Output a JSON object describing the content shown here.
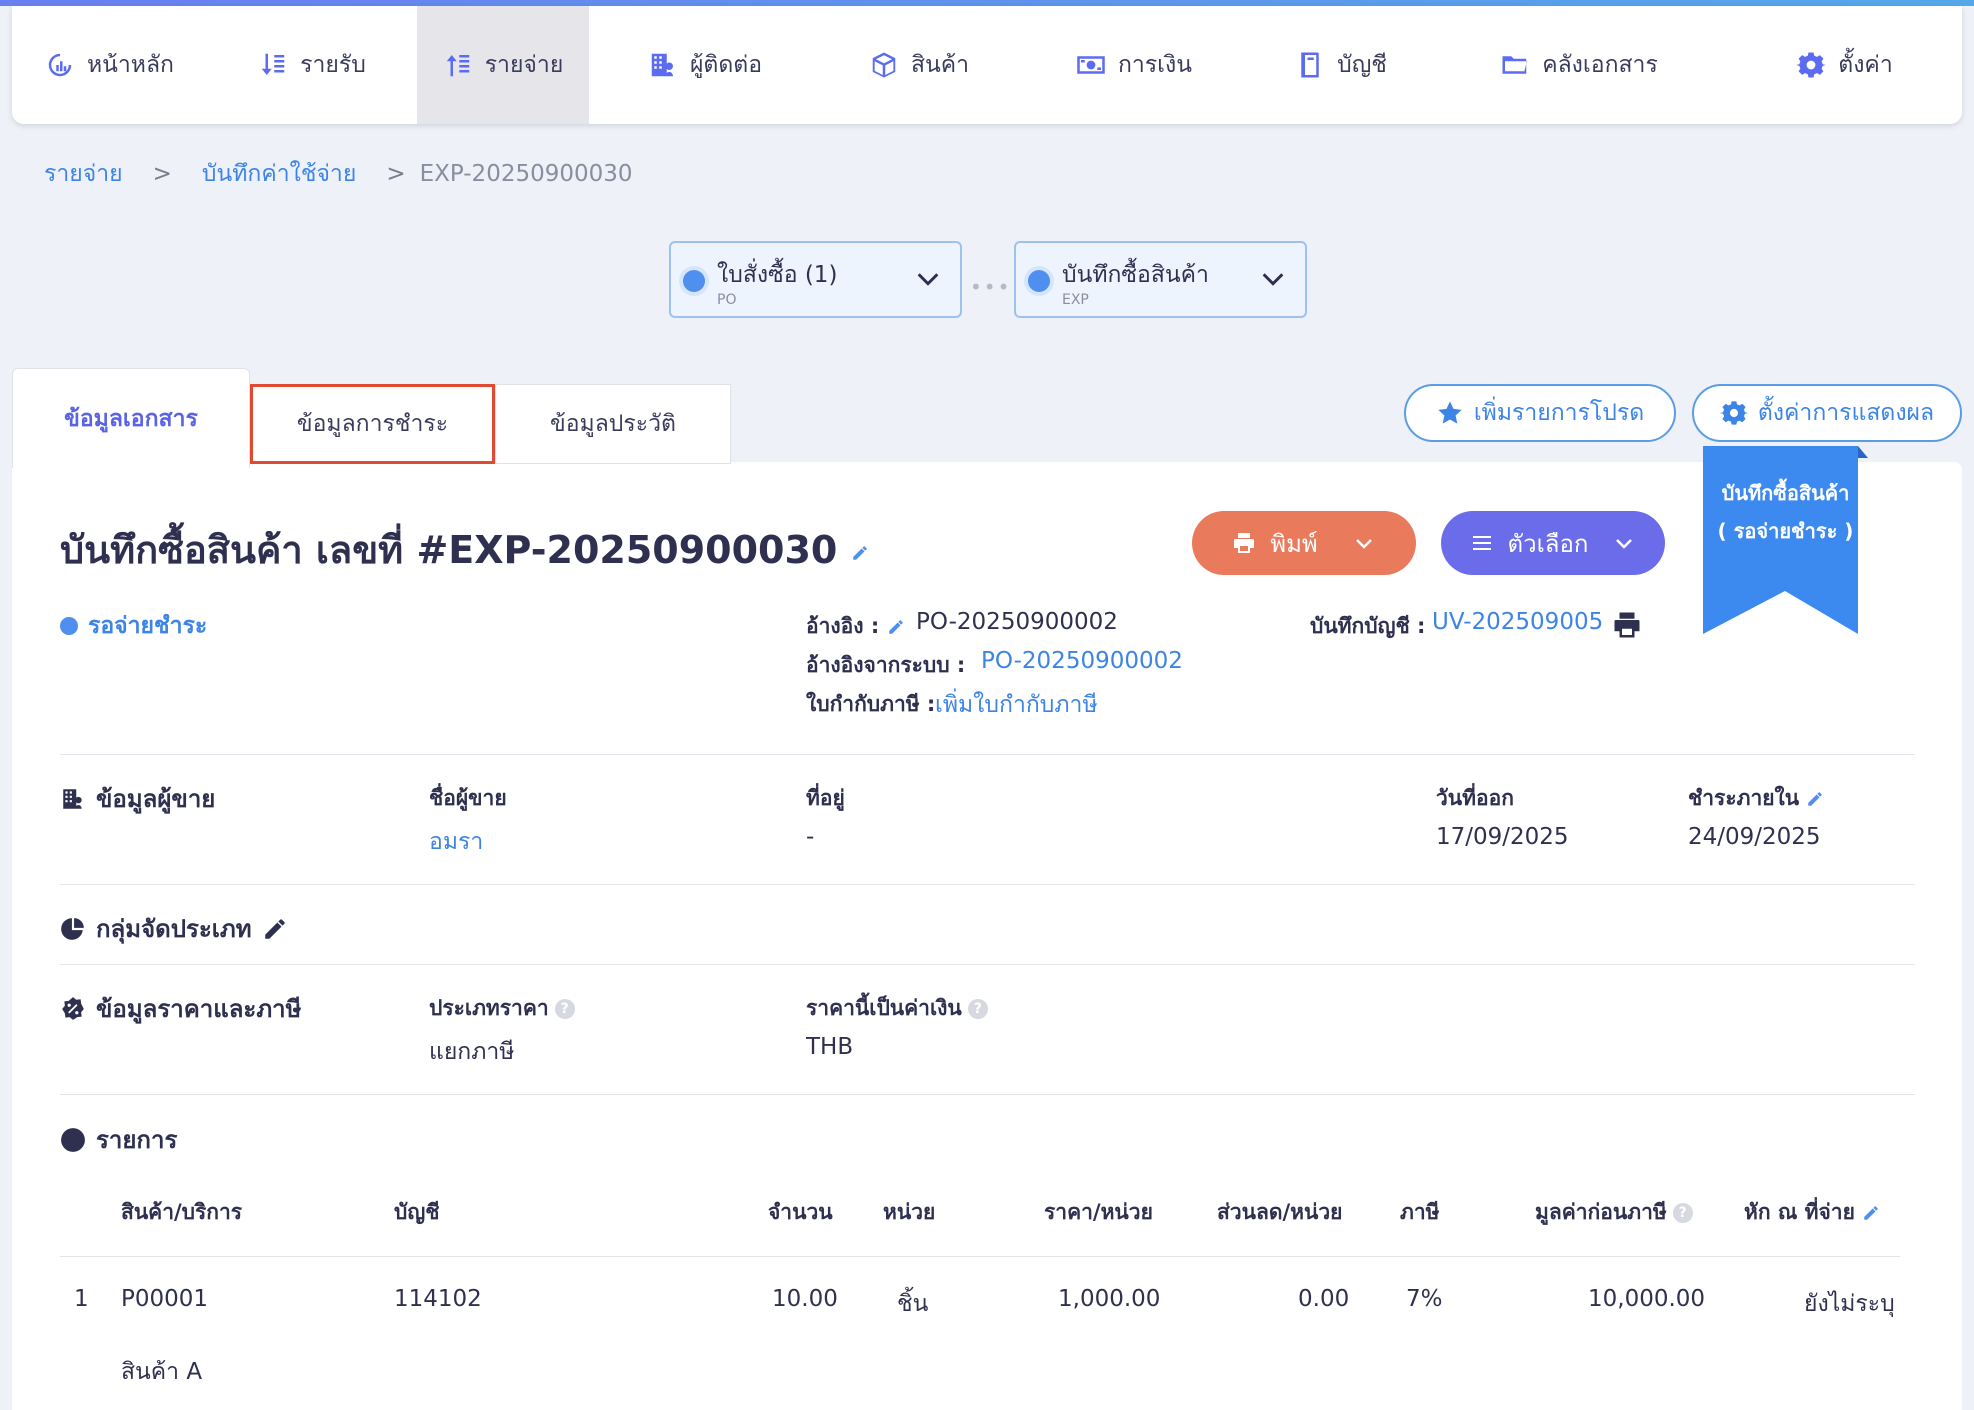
{
  "nav": [
    {
      "label": "หน้าหลัก",
      "icon": "dashboard-icon"
    },
    {
      "label": "รายรับ",
      "icon": "income-icon"
    },
    {
      "label": "รายจ่าย",
      "icon": "expense-icon"
    },
    {
      "label": "ผู้ติดต่อ",
      "icon": "contacts-icon"
    },
    {
      "label": "สินค้า",
      "icon": "box-icon"
    },
    {
      "label": "การเงิน",
      "icon": "money-icon"
    },
    {
      "label": "บัญชี",
      "icon": "book-icon"
    },
    {
      "label": "คลังเอกสาร",
      "icon": "folder-icon"
    },
    {
      "label": "ตั้งค่า",
      "icon": "gear-icon"
    }
  ],
  "breadcrumb": {
    "item1": "รายจ่าย",
    "item2": "บันทึกค่าใช้จ่าย",
    "current": "EXP-20250900030",
    "sep": ">"
  },
  "flow": {
    "po_title": "ใบสั่งซื้อ (1)",
    "po_sub": "PO",
    "exp_title": "บันทึกซื้อสินค้า",
    "exp_sub": "EXP",
    "dots": "•••"
  },
  "tabs": {
    "doc": "ข้อมูลเอกสาร",
    "payment": "ข้อมูลการชำระ",
    "history": "ข้อมูลประวัติ"
  },
  "actions": {
    "favorite": "เพิ่มรายการโปรด",
    "display": "ตั้งค่าการแสดงผล",
    "print": "พิมพ์",
    "options": "ตัวเลือก"
  },
  "ribbon": {
    "line1": "บันทึกซื้อสินค้า",
    "line2": "( รอจ่ายชำระ )"
  },
  "doc": {
    "title": "บันทึกซื้อสินค้า เลขที่ #EXP-20250900030",
    "status": "รอจ่ายชำระ",
    "ref_label": "อ้างอิง :",
    "ref_value": "PO-20250900002",
    "sysref_label": "อ้างอิงจากระบบ :",
    "sysref_value": "PO-20250900002",
    "tax_label": "ใบกำกับภาษี :",
    "tax_value": "เพิ่มใบกำกับภาษี",
    "journal_label": "บันทึกบัญชี :",
    "journal_value": "UV-202509005"
  },
  "vendor": {
    "section": "ข้อมูลผู้ขาย",
    "name_label": "ชื่อผู้ขาย",
    "name_value": "อมรา",
    "addr_label": "ที่อยู่",
    "addr_value": "-",
    "issue_label": "วันที่ออก",
    "issue_value": "17/09/2025",
    "due_label": "ชำระภายใน",
    "due_value": "24/09/2025"
  },
  "category": {
    "section": "กลุ่มจัดประเภท"
  },
  "pricing": {
    "section": "ข้อมูลราคาและภาษี",
    "type_label": "ประเภทราคา",
    "type_value": "แยกภาษี",
    "currency_label": "ราคานี้เป็นค่าเงิน",
    "currency_value": "THB"
  },
  "items": {
    "section": "รายการ",
    "headers": {
      "product": "สินค้า/บริการ",
      "account": "บัญชี",
      "qty": "จำนวน",
      "unit": "หน่วย",
      "price": "ราคา/หน่วย",
      "discount": "ส่วนลด/หน่วย",
      "tax": "ภาษี",
      "pretax": "มูลค่าก่อนภาษี",
      "wht": "หัก ณ ที่จ่าย"
    },
    "rows": [
      {
        "no": "1",
        "code": "P00001",
        "name": "สินค้า A",
        "account": "114102",
        "qty": "10.00",
        "unit": "ชิ้น",
        "price": "1,000.00",
        "discount": "0.00",
        "tax": "7%",
        "pretax": "10,000.00",
        "wht": "ยังไม่ระบุ"
      }
    ]
  },
  "colors": {
    "accent": "#3c84e6",
    "print": "#ea7a5c",
    "options": "#6a6cea",
    "highlight": "#e04a33"
  }
}
